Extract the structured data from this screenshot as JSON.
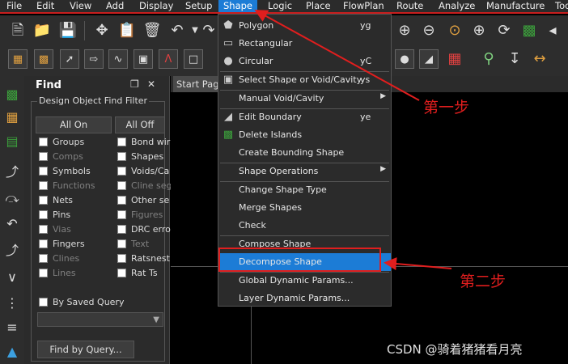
{
  "menubar": {
    "items": [
      "File",
      "Edit",
      "View",
      "Add",
      "Display",
      "Setup",
      "Shape",
      "Logic",
      "Place",
      "FlowPlan",
      "Route",
      "Analyze",
      "Manufacture",
      "Tools"
    ]
  },
  "find_panel": {
    "title": "Find",
    "pin_icon": "restore-icon",
    "close_label": "✕",
    "group_label": "Design Object Find Filter",
    "all_on": "All On",
    "all_off": "All Off",
    "left_col": [
      {
        "label": "Groups",
        "dim": false
      },
      {
        "label": "Comps",
        "dim": true
      },
      {
        "label": "Symbols",
        "dim": false
      },
      {
        "label": "Functions",
        "dim": true
      },
      {
        "label": "Nets",
        "dim": false
      },
      {
        "label": "Pins",
        "dim": false
      },
      {
        "label": "Vias",
        "dim": true
      },
      {
        "label": "Fingers",
        "dim": false
      },
      {
        "label": "Clines",
        "dim": true
      },
      {
        "label": "Lines",
        "dim": true
      }
    ],
    "right_col": [
      {
        "label": "Bond wir",
        "dim": false
      },
      {
        "label": "Shapes",
        "dim": false
      },
      {
        "label": "Voids/Ca",
        "dim": false
      },
      {
        "label": "Cline seg",
        "dim": true
      },
      {
        "label": "Other se",
        "dim": false
      },
      {
        "label": "Figures",
        "dim": true
      },
      {
        "label": "DRC erro",
        "dim": false
      },
      {
        "label": "Text",
        "dim": true
      },
      {
        "label": "Ratsnest",
        "dim": false
      },
      {
        "label": "Rat Ts",
        "dim": false
      }
    ],
    "saved_query_label": "By Saved Query",
    "query_button": "Find by Query..."
  },
  "canvas": {
    "tab_label": "Start Page"
  },
  "shape_menu": {
    "items": [
      {
        "label": "Polygon",
        "shortcut": "yg",
        "icon": "polygon-icon"
      },
      {
        "label": "Rectangular",
        "shortcut": "",
        "icon": "rectangle-icon"
      },
      {
        "label": "Circular",
        "shortcut": "yC",
        "icon": "circle-icon"
      },
      {
        "label": "Select Shape or Void/Cavity",
        "shortcut": "ys",
        "icon": "select-shape-icon"
      },
      {
        "label": "Manual Void/Cavity",
        "shortcut": "",
        "submenu": true
      },
      {
        "label": "Edit Boundary",
        "shortcut": "ye",
        "icon": "edit-boundary-icon"
      },
      {
        "label": "Delete Islands",
        "shortcut": "",
        "icon": "delete-islands-icon"
      },
      {
        "label": "Create Bounding Shape",
        "shortcut": ""
      },
      {
        "label": "Shape Operations",
        "shortcut": "",
        "submenu": true
      },
      {
        "label": "Change Shape Type",
        "shortcut": ""
      },
      {
        "label": "Merge Shapes",
        "shortcut": ""
      },
      {
        "label": "Check",
        "shortcut": ""
      },
      {
        "label": "Compose Shape",
        "shortcut": ""
      },
      {
        "label": "Decompose Shape",
        "shortcut": "",
        "highlighted": true
      },
      {
        "label": "Global Dynamic Params...",
        "shortcut": ""
      },
      {
        "label": "Layer Dynamic Params...",
        "shortcut": ""
      }
    ]
  },
  "annotations": {
    "step1": "第一步",
    "step2": "第二步"
  },
  "watermark": "CSDN @骑着猪猪看月亮",
  "colors": {
    "accent": "#1c7cd6",
    "annotation": "#e01e1e"
  }
}
